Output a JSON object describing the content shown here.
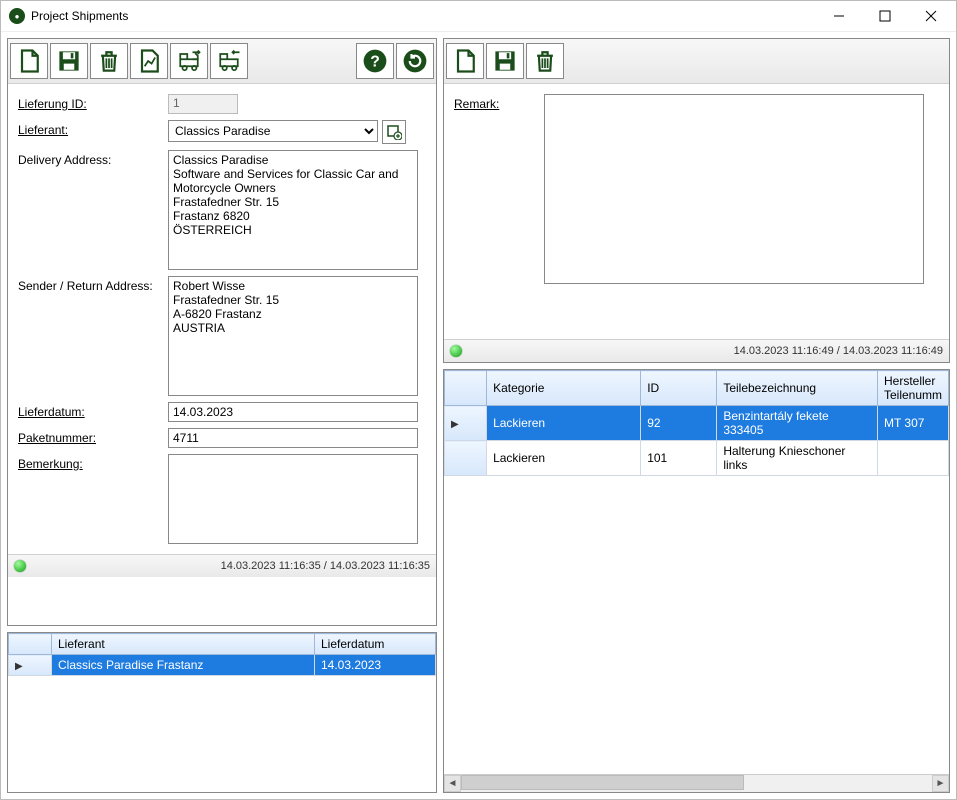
{
  "window": {
    "title": "Project Shipments"
  },
  "left": {
    "toolbar": {
      "new": "new",
      "save": "save",
      "delete": "delete",
      "stats": "stats",
      "ship_out": "ship-out",
      "ship_in": "ship-in",
      "help": "help",
      "refresh": "refresh"
    },
    "labels": {
      "lieferung_id": "Lieferung ID:",
      "lieferant": "Lieferant:",
      "delivery_addr": "Delivery Address:",
      "sender_addr": "Sender / Return Address:",
      "lieferdatum": "Lieferdatum:",
      "paketnummer": "Paketnummer:",
      "bemerkung": "Bemerkung:"
    },
    "values": {
      "lieferung_id": "1",
      "lieferant_selected": "Classics Paradise",
      "delivery_addr": "Classics Paradise\nSoftware and Services for Classic Car and Motorcycle Owners\nFrastafedner Str. 15\nFrastanz 6820\nÖSTERREICH",
      "sender_addr": "Robert Wisse\nFrastafedner Str. 15\nA-6820 Frastanz\nAUSTRIA",
      "lieferdatum": "14.03.2023",
      "paketnummer": "4711",
      "bemerkung": ""
    },
    "status": "14.03.2023 11:16:35 / 14.03.2023 11:16:35",
    "grid": {
      "headers": {
        "lieferant": "Lieferant",
        "lieferdatum": "Lieferdatum"
      },
      "rows": [
        {
          "lieferant": "Classics Paradise Frastanz",
          "lieferdatum": "14.03.2023",
          "selected": true
        }
      ]
    }
  },
  "right": {
    "toolbar": {
      "new": "new",
      "save": "save",
      "delete": "delete"
    },
    "labels": {
      "remark": "Remark:"
    },
    "values": {
      "remark": ""
    },
    "status": "14.03.2023 11:16:49 / 14.03.2023 11:16:49",
    "grid": {
      "headers": {
        "kategorie": "Kategorie",
        "id": "ID",
        "teilebez": "Teilebezeichnung",
        "hersteller": "Hersteller Teilenumm"
      },
      "rows": [
        {
          "kategorie": "Lackieren",
          "id": "92",
          "teilebez": "Benzintartály fekete 333405",
          "hersteller": "MT 307",
          "selected": true
        },
        {
          "kategorie": "Lackieren",
          "id": "101",
          "teilebez": "Halterung Knieschoner links",
          "hersteller": "",
          "selected": false
        }
      ]
    }
  }
}
